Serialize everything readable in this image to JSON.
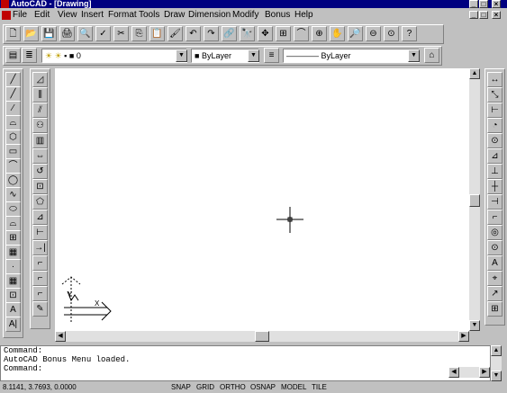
{
  "window": {
    "title": "AutoCAD - [Drawing]",
    "min": "_",
    "max": "□",
    "close": "×",
    "doc_min": "_",
    "doc_max": "□",
    "doc_close": "×"
  },
  "menu": [
    "File",
    "Edit",
    "View",
    "Insert",
    "Format",
    "Tools",
    "Draw",
    "Dimension",
    "Modify",
    "Bonus",
    "Help"
  ],
  "standard_toolbar": [
    "🗋",
    "📂",
    "💾",
    "🖨",
    "🔍",
    "✓",
    "✂",
    "⎘",
    "📋",
    "🖌",
    "↶",
    "↷",
    "🔗",
    "🔭",
    "✥",
    "⊞",
    "⌒",
    "⊕",
    "✋",
    "🔎",
    "⊖",
    "⊙",
    "?"
  ],
  "layer_combo": "0",
  "color_combo": "ByLayer",
  "linetype_combo": "———— ByLayer",
  "draw_tools": [
    "╱",
    "╱",
    "⁄",
    "⌓",
    "⬡",
    "▭",
    "⌒",
    "◯",
    "∿",
    "⬭",
    "⌓",
    "⊞",
    "▦",
    "·",
    "▦",
    "⊡",
    "A",
    "A|"
  ],
  "modify_tools": [
    "◿",
    "⫼",
    "⫽",
    "⚇",
    "▥",
    "⇔",
    "↺",
    "⊡",
    "⬠",
    "⊿",
    "⊢",
    "→|",
    "⌐",
    "⌐",
    "⌐",
    "✎"
  ],
  "dim_tools": [
    "↔",
    "⤡",
    "⊢",
    "◔",
    "⊙",
    "⊿",
    "⊥",
    "┼",
    "⊣",
    "⌐",
    "◎",
    "⊙",
    "A",
    "⌖",
    "↗",
    "⊞"
  ],
  "ucs": {
    "x_label": "X",
    "y_label": "Y",
    "w_label": "W"
  },
  "command_lines": [
    "Command:",
    "AutoCAD Bonus Menu loaded.",
    "Command:"
  ],
  "status": {
    "coords": "8.1141, 3.7693, 0.0000",
    "snap": "SNAP",
    "grid": "GRID",
    "ortho": "ORTHO",
    "osnap": "OSNAP",
    "model": "MODEL",
    "tile": "TILE"
  }
}
